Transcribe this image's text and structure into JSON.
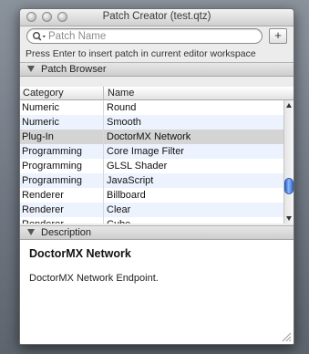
{
  "window": {
    "title": "Patch Creator (test.qtz)"
  },
  "search": {
    "placeholder": "Patch Name",
    "value": ""
  },
  "toolbar": {
    "add_label": "+"
  },
  "hint": "Press Enter to insert patch in current editor workspace",
  "patch_browser": {
    "header": "Patch Browser",
    "columns": [
      "Category",
      "Name"
    ],
    "rows": [
      {
        "category": "Numeric",
        "name": "Round"
      },
      {
        "category": "Numeric",
        "name": "Smooth"
      },
      {
        "category": "Plug-In",
        "name": "DoctorMX Network"
      },
      {
        "category": "Programming",
        "name": "Core Image Filter"
      },
      {
        "category": "Programming",
        "name": "GLSL Shader"
      },
      {
        "category": "Programming",
        "name": "JavaScript"
      },
      {
        "category": "Renderer",
        "name": "Billboard"
      },
      {
        "category": "Renderer",
        "name": "Clear"
      },
      {
        "category": "Renderer",
        "name": "Cube"
      }
    ],
    "selected_index": 2
  },
  "description": {
    "header": "Description",
    "title": "DoctorMX Network",
    "text": "DoctorMX Network Endpoint."
  },
  "icons": [
    "close-button-icon",
    "minimize-button-icon",
    "zoom-button-icon",
    "search-icon",
    "disclosure-triangle-icon",
    "resize-grip-icon"
  ]
}
